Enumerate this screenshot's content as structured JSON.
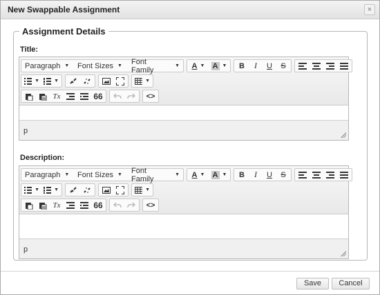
{
  "dialog": {
    "title": "New Swappable Assignment",
    "close_glyph": "×",
    "section_legend": "Assignment Details"
  },
  "fields": {
    "title_label": "Title:",
    "description_label": "Description:"
  },
  "editor": {
    "paragraph": "Paragraph",
    "font_sizes": "Font Sizes",
    "font_family": "Font Family",
    "text_color_glyph": "A",
    "bg_color_glyph": "A",
    "bold_glyph": "B",
    "italic_glyph": "I",
    "underline_glyph": "U",
    "strike_glyph": "S",
    "clear_format_glyph": "Tx",
    "blockquote_glyph": "66",
    "source_glyph": "<>",
    "status_path": "p"
  },
  "footer": {
    "save_label": "Save",
    "cancel_label": "Cancel"
  }
}
